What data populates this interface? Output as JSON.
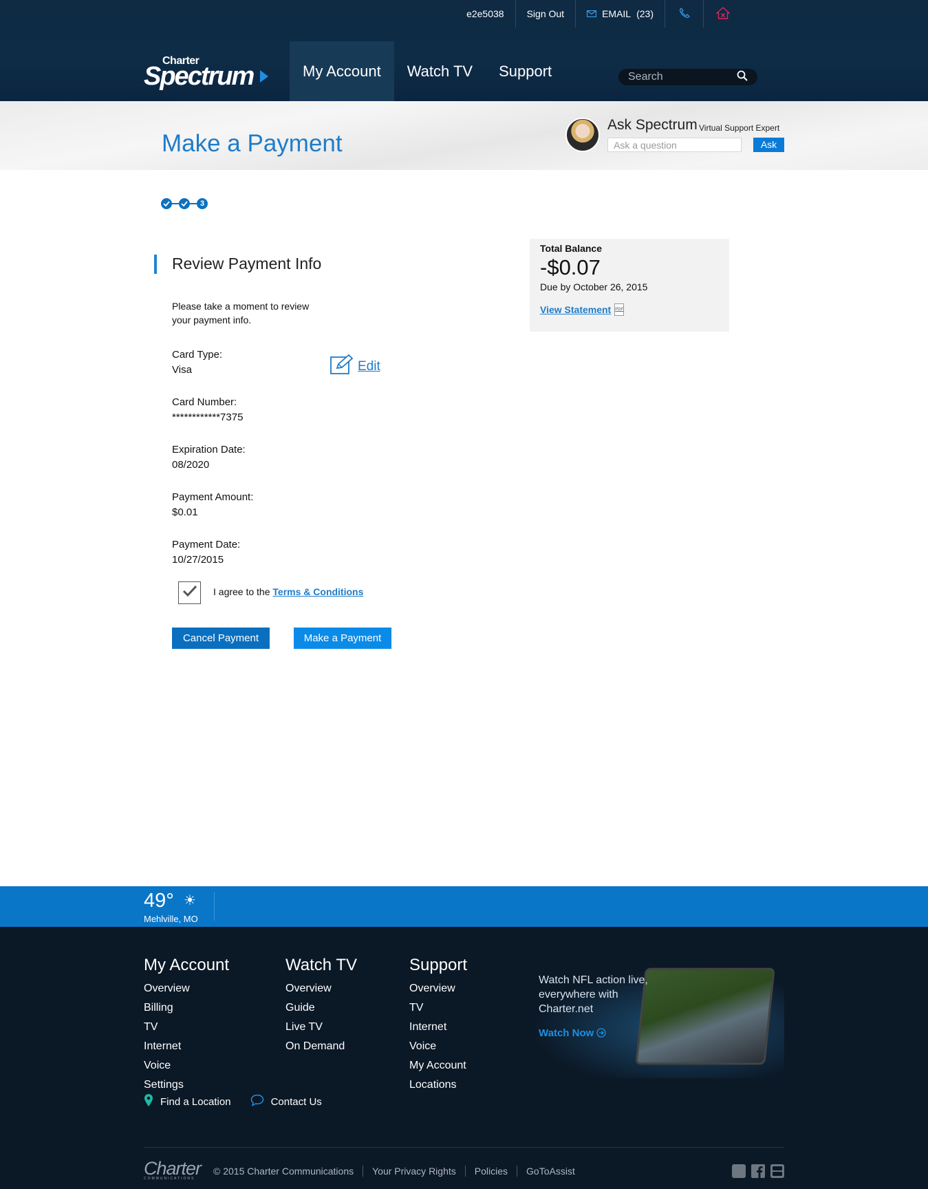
{
  "header": {
    "username": "e2e5038",
    "sign_out": "Sign Out",
    "email_label": "EMAIL",
    "email_count": "(23)",
    "logo_small": "Charter",
    "logo_main": "Spectrum",
    "nav": [
      "My Account",
      "Watch TV",
      "Support"
    ],
    "search_placeholder": "Search"
  },
  "band": {
    "title": "Make a Payment",
    "ask_title": "Ask Spectrum",
    "ask_sub": "Virtual Support Expert",
    "ask_placeholder": "Ask a question",
    "ask_button": "Ask"
  },
  "steps": {
    "current": "3"
  },
  "review": {
    "title": "Review Payment Info",
    "intro": "Please take a moment to review your payment info.",
    "edit": "Edit",
    "fields": [
      {
        "label": "Card Type:",
        "value": "Visa"
      },
      {
        "label": "Card Number:",
        "value": "************7375"
      },
      {
        "label": "Expiration Date:",
        "value": "08/2020"
      },
      {
        "label": "Payment Amount:",
        "value": "$0.01"
      },
      {
        "label": "Payment Date:",
        "value": "10/27/2015"
      }
    ],
    "agree_text": "I agree to the ",
    "terms_link": "Terms & Conditions",
    "cancel_button": "Cancel Payment",
    "pay_button": "Make a Payment"
  },
  "balance": {
    "label": "Total Balance",
    "amount": "-$0.07",
    "due": "Due by October 26, 2015",
    "link": "View Statement",
    "pdf": "PDF"
  },
  "weather": {
    "temp": "49°",
    "location": "Mehlville, MO"
  },
  "footer": {
    "columns": [
      {
        "title": "My Account",
        "links": [
          "Overview",
          "Billing",
          "TV",
          "Internet",
          "Voice",
          "Settings"
        ]
      },
      {
        "title": "Watch TV",
        "links": [
          "Overview",
          "Guide",
          "Live TV",
          "On Demand"
        ]
      },
      {
        "title": "Support",
        "links": [
          "Overview",
          "TV",
          "Internet",
          "Voice",
          "My Account",
          "Locations"
        ]
      }
    ],
    "promo_text": "Watch NFL action live, everywhere with Charter.net",
    "promo_link": "Watch Now",
    "find_location": "Find a Location",
    "contact_us": "Contact Us",
    "logo": "Charter",
    "logo_sub": "COMMUNICATIONS",
    "legal": [
      "© 2015 Charter Communications",
      "Your Privacy Rights",
      "Policies",
      "GoToAssist"
    ]
  },
  "colors": {
    "accent": "#1f7cc9",
    "header": "#0f2a42",
    "weather": "#0a76c8",
    "footer": "#0b1826"
  }
}
